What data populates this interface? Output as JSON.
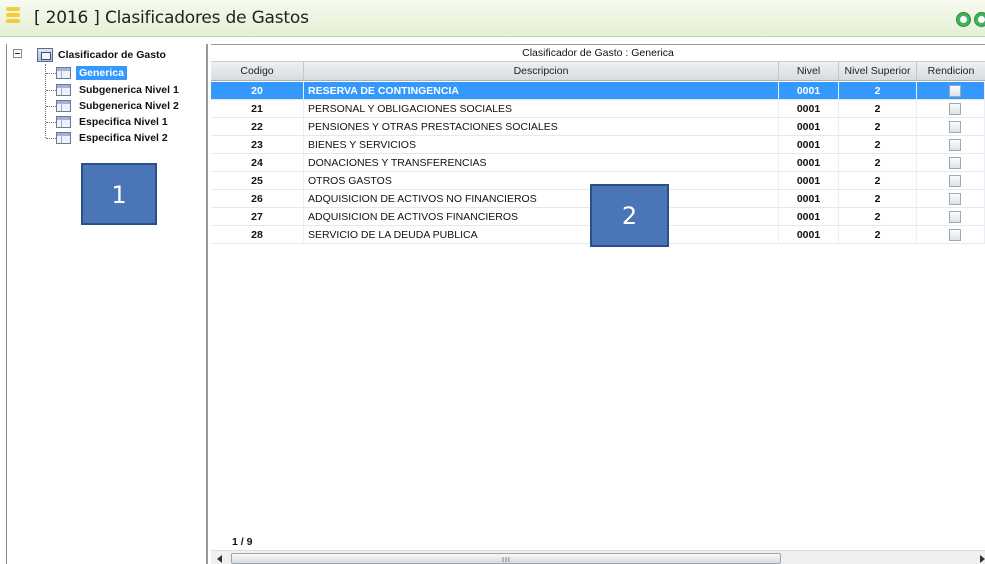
{
  "window": {
    "title": "[ 2016 ] Clasificadores de Gastos",
    "menu_icon": "hamburger-icon",
    "minimize_icon": "minimize-circle-icon",
    "close_icon": "close-circle-icon",
    "accent_color": "#43b05a"
  },
  "tree": {
    "root_label": "Clasificador de Gasto",
    "items": [
      {
        "label": "Generica",
        "selected": true
      },
      {
        "label": "Subgenerica Nivel 1",
        "selected": false
      },
      {
        "label": "Subgenerica Nivel 2",
        "selected": false
      },
      {
        "label": "Especifica Nivel 1",
        "selected": false
      },
      {
        "label": "Especifica Nivel 2",
        "selected": false
      }
    ],
    "selection_color": "#3399ff"
  },
  "annotations": {
    "badge1": "1",
    "badge2": "2"
  },
  "grid": {
    "caption": "Clasificador de Gasto : Generica",
    "columns": [
      "Codigo",
      "Descripcion",
      "Nivel",
      "Nivel Superior",
      "Rendicion"
    ],
    "rows": [
      {
        "codigo": "20",
        "descripcion": "RESERVA  DE CONTINGENCIA",
        "nivel": "0001",
        "superior": "2",
        "rendicion": false,
        "selected": true
      },
      {
        "codigo": "21",
        "descripcion": "PERSONAL Y OBLIGACIONES SOCIALES",
        "nivel": "0001",
        "superior": "2",
        "rendicion": false,
        "selected": false
      },
      {
        "codigo": "22",
        "descripcion": "PENSIONES Y OTRAS PRESTACIONES SOCIALES",
        "nivel": "0001",
        "superior": "2",
        "rendicion": false,
        "selected": false
      },
      {
        "codigo": "23",
        "descripcion": "BIENES Y SERVICIOS",
        "nivel": "0001",
        "superior": "2",
        "rendicion": false,
        "selected": false
      },
      {
        "codigo": "24",
        "descripcion": "DONACIONES Y TRANSFERENCIAS",
        "nivel": "0001",
        "superior": "2",
        "rendicion": false,
        "selected": false
      },
      {
        "codigo": "25",
        "descripcion": "OTROS GASTOS",
        "nivel": "0001",
        "superior": "2",
        "rendicion": false,
        "selected": false
      },
      {
        "codigo": "26",
        "descripcion": "ADQUISICION DE ACTIVOS NO FINANCIEROS",
        "nivel": "0001",
        "superior": "2",
        "rendicion": false,
        "selected": false
      },
      {
        "codigo": "27",
        "descripcion": "ADQUISICION DE ACTIVOS FINANCIEROS",
        "nivel": "0001",
        "superior": "2",
        "rendicion": false,
        "selected": false
      },
      {
        "codigo": "28",
        "descripcion": "SERVICIO DE LA DEUDA PUBLICA",
        "nivel": "0001",
        "superior": "2",
        "rendicion": false,
        "selected": false
      }
    ],
    "pager": "1 / 9",
    "scroll_grip": "III"
  }
}
